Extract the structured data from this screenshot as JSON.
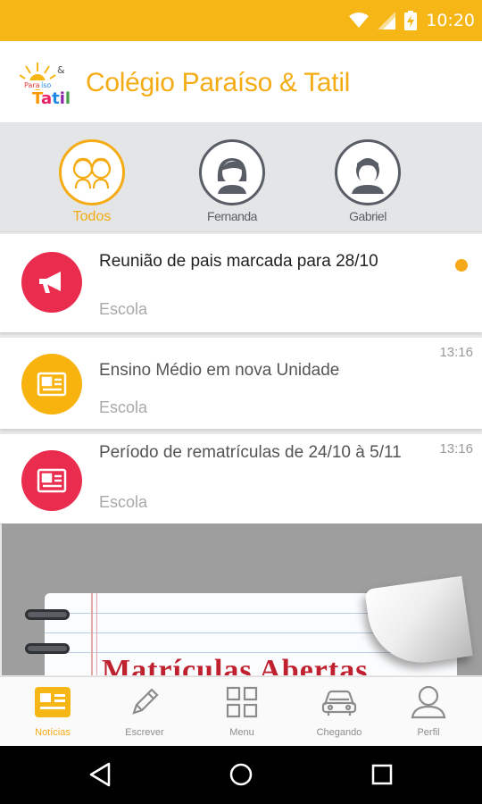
{
  "status_bar": {
    "time": "10:20",
    "icons": [
      "wifi-icon",
      "signal-icon",
      "battery-charging-icon"
    ],
    "background": "#f6b716"
  },
  "header": {
    "title": "Colégio Paraíso & Tatil",
    "accent_color": "#f5ac14"
  },
  "filters": [
    {
      "label": "Todos",
      "icon": "group-icon",
      "selected": true
    },
    {
      "label": "Fernanda",
      "icon": "girl-avatar-icon",
      "selected": false
    },
    {
      "label": "Gabriel",
      "icon": "boy-avatar-icon",
      "selected": false
    }
  ],
  "feed": [
    {
      "title": "Reunião de pais marcada para 28/10",
      "source": "Escola",
      "time": "",
      "unread": true,
      "icon": "megaphone-icon",
      "icon_color": "#ea2d4e"
    },
    {
      "title": "Ensino Médio em nova Unidade",
      "source": "Escola",
      "time": "13:16",
      "unread": false,
      "icon": "newspaper-icon",
      "icon_color": "#f8b30e"
    },
    {
      "title": "Período de rematrículas de 24/10 à 5/11",
      "source": "Escola",
      "time": "13:16",
      "unread": false,
      "icon": "newspaper-icon",
      "icon_color": "#ea2d4e"
    }
  ],
  "banner": {
    "text": "Matrículas Abertas"
  },
  "bottom_nav": [
    {
      "label": "Notícias",
      "icon": "news-icon",
      "active": true
    },
    {
      "label": "Escrever",
      "icon": "pencil-icon",
      "active": false
    },
    {
      "label": "Menu",
      "icon": "grid-icon",
      "active": false
    },
    {
      "label": "Chegando",
      "icon": "car-icon",
      "active": false
    },
    {
      "label": "Perfil",
      "icon": "person-icon",
      "active": false
    }
  ],
  "system_nav": [
    "back-icon",
    "home-icon",
    "recents-icon"
  ]
}
